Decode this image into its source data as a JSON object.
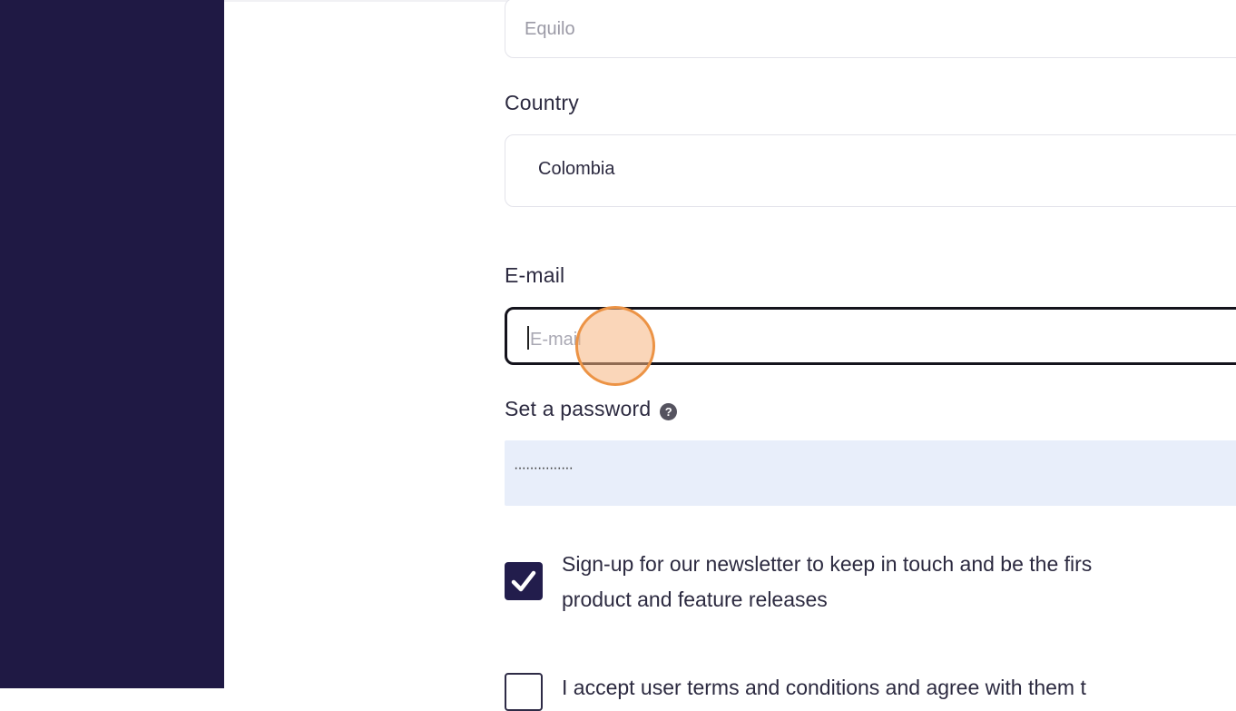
{
  "form": {
    "company": {
      "value": "Equilo"
    },
    "country": {
      "label": "Country",
      "value": "Colombia"
    },
    "email": {
      "label": "E-mail",
      "placeholder": "E-mail"
    },
    "password": {
      "label": "Set a password",
      "value": "···············",
      "help_icon": "question-circle-icon"
    },
    "newsletter": {
      "checked": true,
      "line1": "Sign-up for our newsletter to keep in touch and be the firs",
      "line2": "product and feature releases"
    },
    "terms": {
      "checked": false,
      "text": "I accept user terms and conditions and agree with them t"
    }
  },
  "colors": {
    "sidebar": "#1f1944",
    "checkbox_checked": "#221d4c",
    "focus_border": "#14131c",
    "autofill_bg": "#e8eefa",
    "cursor_highlight": "#ec9345"
  }
}
